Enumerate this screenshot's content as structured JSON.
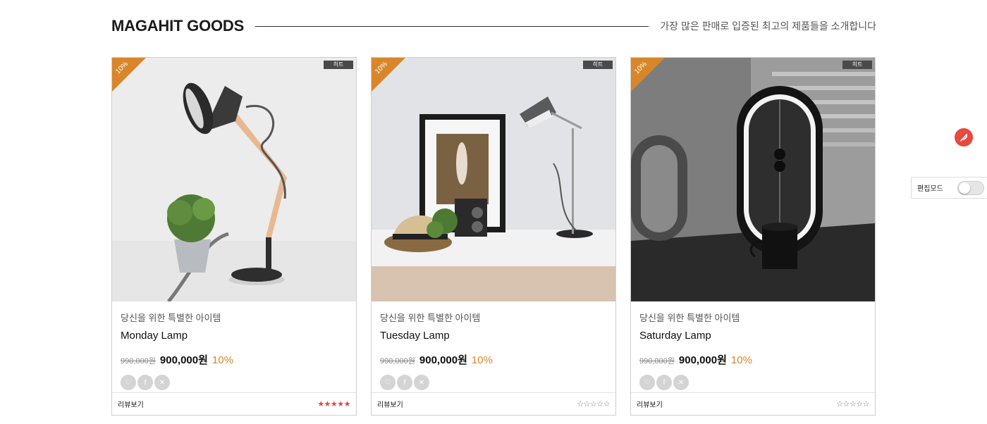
{
  "header": {
    "title": "MAGAHIT GOODS",
    "tagline": "가장 많은 판매로 입증된 최고의 제품들을 소개합니다"
  },
  "colors": {
    "accent": "#d9862a",
    "star_filled": "#e04848",
    "fab": "#e8483d"
  },
  "products": [
    {
      "ribbon": "10%",
      "badge": "히트",
      "subtitle": "당신을 위한 특별한 아이템",
      "name": "Monday Lamp",
      "old_price": "990,000원",
      "price": "900,000원",
      "discount": "10%",
      "review_label": "리뷰보기",
      "rating": 5,
      "stars": "★★★★★",
      "image": "desk-lamp-with-plant"
    },
    {
      "ribbon": "10%",
      "badge": "히트",
      "subtitle": "당신을 위한 특별한 아이템",
      "name": "Tuesday Lamp",
      "old_price": "990,000원",
      "price": "900,000원",
      "discount": "10%",
      "review_label": "리뷰보기",
      "rating": 0,
      "stars": "☆☆☆☆☆",
      "image": "shelf-with-frame-and-lamp"
    },
    {
      "ribbon": "10%",
      "badge": "히트",
      "subtitle": "당신을 위한 특별한 아이템",
      "name": "Saturday Lamp",
      "old_price": "990,000원",
      "price": "900,000원",
      "discount": "10%",
      "review_label": "리뷰보기",
      "rating": 0,
      "stars": "☆☆☆☆☆",
      "image": "balance-lamp-monochrome"
    }
  ],
  "social_icons": [
    "heart-icon",
    "facebook-icon",
    "x-icon"
  ],
  "social_glyphs": [
    "♡",
    "f",
    "✕"
  ],
  "edit_mode": {
    "label": "편집모드",
    "enabled": false
  },
  "fab_icon": "feather-icon"
}
